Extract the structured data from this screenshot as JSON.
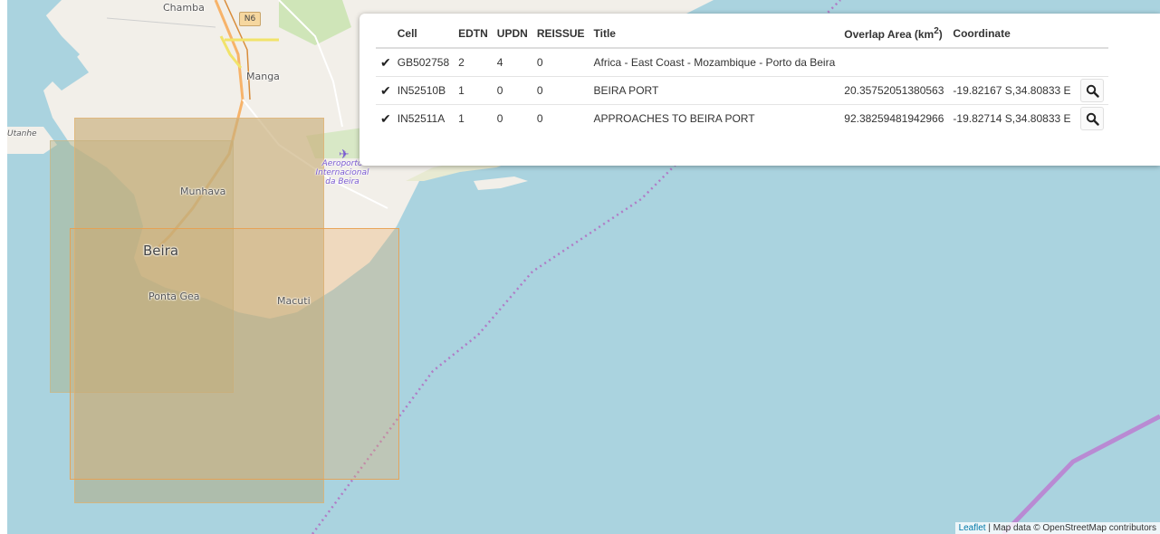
{
  "map": {
    "labels": {
      "chamba": "Chamba",
      "road": "N6",
      "manga": "Manga",
      "utanhe": "Utanhe",
      "munhava": "Munhava",
      "beira": "Beira",
      "ponta_gea": "Ponta Gea",
      "macuti": "Macuti",
      "airport_1": "Aeroporto",
      "airport_2": "Internacional",
      "airport_3": "da Beira"
    },
    "attribution": {
      "leaflet": "Leaflet",
      "text": "| Map data © OpenStreetMap contributors"
    },
    "colors": {
      "water": "#aad3df",
      "land": "#f2efe9",
      "route": "#b07cc6"
    }
  },
  "table": {
    "headers": {
      "cell": "Cell",
      "edtn": "EDTN",
      "updn": "UPDN",
      "reissue": "REISSUE",
      "title": "Title",
      "overlap": "Overlap Area (km",
      "overlap_sup": "2",
      "overlap_end": ")",
      "coordinate": "Coordinate"
    },
    "rows": [
      {
        "cell": "GB502758",
        "edtn": "2",
        "updn": "4",
        "reissue": "0",
        "title": "Africa - East Coast - Mozambique - Porto da Beira",
        "overlap": "",
        "coordinate": ""
      },
      {
        "cell": "IN52510B",
        "edtn": "1",
        "updn": "0",
        "reissue": "0",
        "title": "BEIRA PORT",
        "overlap": "20.35752051380563",
        "coordinate": "-19.82167 S,34.80833 E"
      },
      {
        "cell": "IN52511A",
        "edtn": "1",
        "updn": "0",
        "reissue": "0",
        "title": "APPROACHES TO BEIRA PORT",
        "overlap": "92.38259481942966",
        "coordinate": "-19.82714 S,34.80833 E"
      }
    ],
    "check_icon": "checkmark-icon",
    "zoom_icon": "magnifier-icon"
  }
}
